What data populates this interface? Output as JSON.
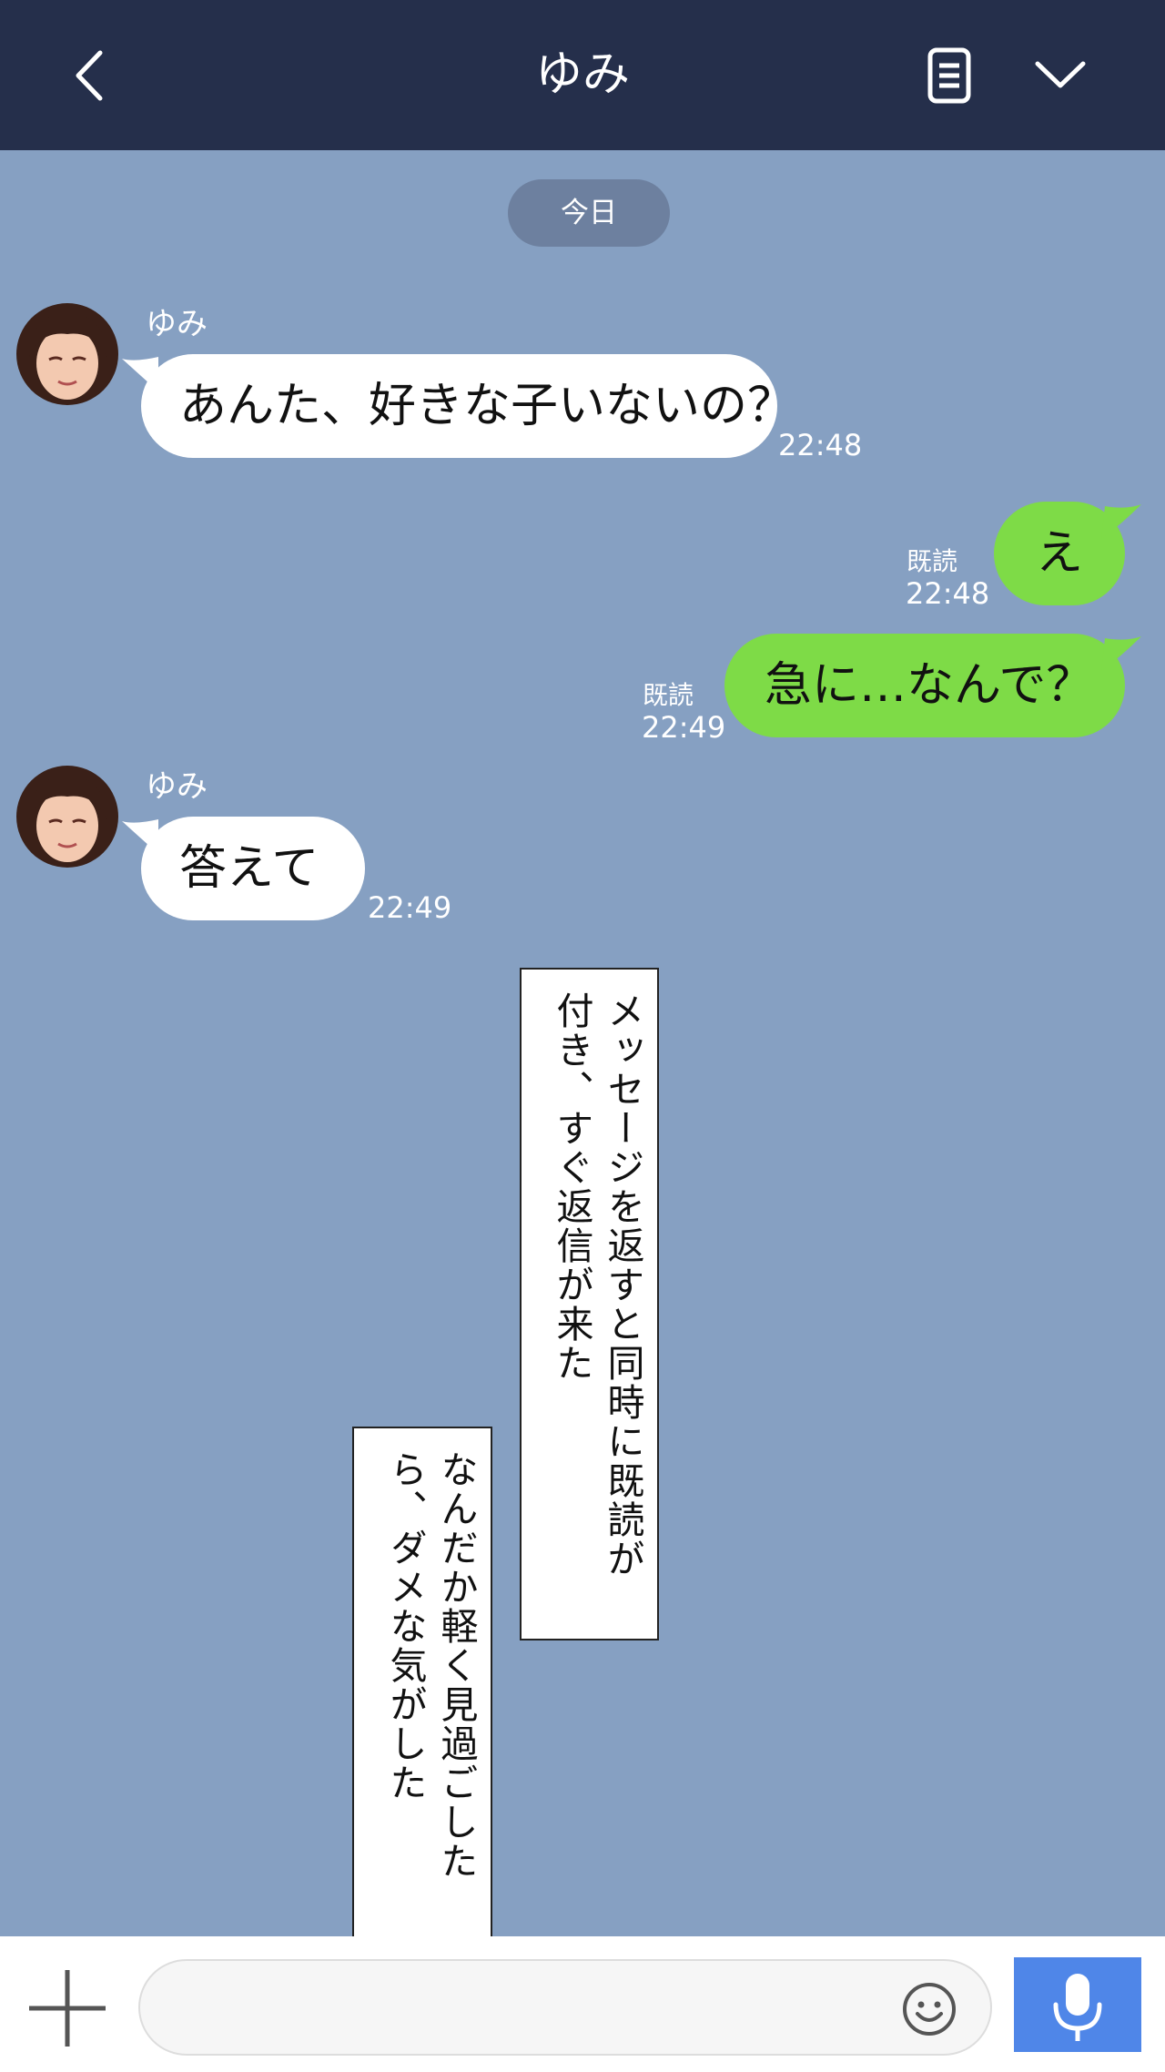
{
  "header": {
    "title": "ゆみ",
    "back_icon": "chevron-left-icon",
    "notes_icon": "note-icon",
    "menu_icon": "chevron-down-icon"
  },
  "date_separator": "今日",
  "messages": [
    {
      "sender": "ゆみ",
      "text": "あんた、好きな子いないの？",
      "time": "22:48",
      "direction": "incoming"
    },
    {
      "text": "え",
      "read": "既読",
      "time": "22:48",
      "direction": "outgoing"
    },
    {
      "text": "急に…なんで？",
      "read": "既読",
      "time": "22:49",
      "direction": "outgoing"
    },
    {
      "sender": "ゆみ",
      "text": "答えて",
      "time": "22:49",
      "direction": "incoming"
    }
  ],
  "narration": [
    {
      "text": "メッセージを返すと同時に既読が付き、すぐ返信が来た"
    },
    {
      "text": "なんだか軽く見過ごしたら、ダメな気がした"
    }
  ],
  "composer": {
    "plus_icon": "plus-icon",
    "input_value": "",
    "emoji_icon": "smiley-icon",
    "mic_icon": "microphone-icon"
  },
  "colors": {
    "header_bg": "#252f4b",
    "chat_bg": "#86a0c2",
    "incoming_bubble": "#ffffff",
    "outgoing_bubble": "#7edb47",
    "mic_button": "#4f86e8"
  }
}
